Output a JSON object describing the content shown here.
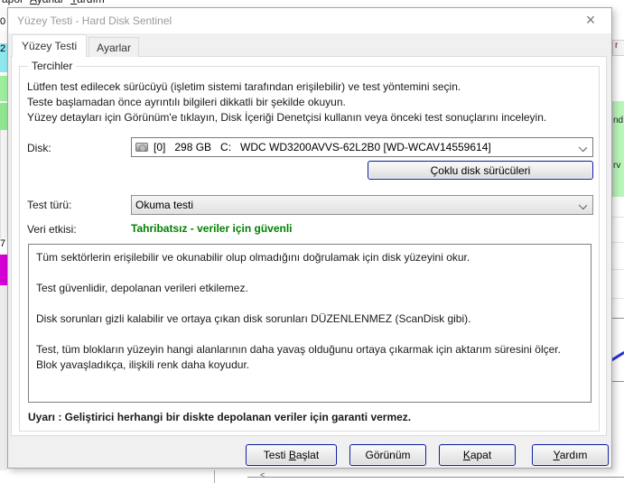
{
  "background": {
    "menu_items": [
      {
        "pre": "apor",
        "key": "",
        "suf": ""
      },
      {
        "pre": "",
        "key": "A",
        "suf": "yarlar"
      },
      {
        "pre": "",
        "key": "Y",
        "suf": "ardım"
      }
    ],
    "left_strip": {
      "digit_top": "0",
      "digit_cyan": "2",
      "digit_mid": "7"
    },
    "right_strip": {
      "tab_fragment": "r",
      "green_fragment_1": "nd",
      "green_fragment_2": "rv"
    },
    "bottom_mark": "<",
    "colors": {
      "cyan_block": "#8fe8f0",
      "green_block_1": "#9cee9c",
      "green_block_2": "#8fe88f",
      "magenta_block": "#d400d4",
      "green_panel": "#b9f6b9",
      "curve_blue": "#2a35d0"
    }
  },
  "dialog": {
    "title": "Yüzey Testi - Hard Disk Sentinel",
    "close_glyph": "×",
    "tabs": [
      {
        "label": "Yüzey Testi"
      },
      {
        "label": "Ayarlar"
      }
    ],
    "group": {
      "title": "Tercihler",
      "instructions": [
        "Lütfen test edilecek sürücüyü (işletim sistemi tarafından erişilebilir) ve test yöntemini seçin.",
        "Teste başlamadan önce ayrıntılı bilgileri dikkatli bir şekilde okuyun.",
        "Yüzey detayları için Görünüm'e tıklayın, Disk İçeriği Denetçisi kullanın veya önceki test sonuçlarını inceleyin."
      ],
      "disk_label": "Disk:",
      "disk_value": "[0]   298 GB   C:   WDC WD3200AVVS-62L2B0 [WD-WCAV14559614]",
      "multi_disk_button": "Çoklu disk sürücüleri",
      "test_type_label": "Test türü:",
      "test_type_value": "Okuma testi",
      "impact_label": "Veri etkisi:",
      "impact_value": "Tahribatsız - veriler için güvenli",
      "impact_color": "#008000",
      "description_paragraphs": [
        "Tüm sektörlerin erişilebilir ve okunabilir olup olmadığını doğrulamak için disk yüzeyini okur.",
        "Test güvenlidir, depolanan verileri etkilemez.",
        "Disk sorunları gizli kalabilir ve ortaya çıkan disk sorunları DÜZENLENMEZ (ScanDisk gibi).",
        "Test, tüm blokların yüzeyin hangi alanlarının daha yavaş olduğunu ortaya çıkarmak için aktarım süresini ölçer. Blok yavaşladıkça, ilişkili renk daha koyudur."
      ],
      "warning": "Uyarı : Geliştirici herhangi bir diskte depolanan veriler için garanti vermez."
    },
    "buttons": [
      {
        "pre": "Testi ",
        "key": "B",
        "suf": "aşlat"
      },
      {
        "pre": "Görünüm",
        "key": "",
        "suf": ""
      },
      {
        "pre": "",
        "key": "K",
        "suf": "apat"
      },
      {
        "pre": "",
        "key": "Y",
        "suf": "ardım"
      }
    ]
  }
}
